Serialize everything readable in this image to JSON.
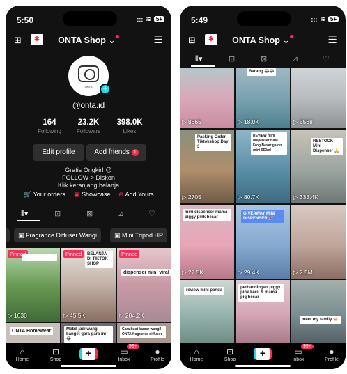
{
  "left": {
    "status": {
      "time": "5:50",
      "signal": "::: ",
      "battery": "5+"
    },
    "header": {
      "title": "ONTA Shop",
      "chevron": "⌄"
    },
    "profile": {
      "avatar_text": "ONTA",
      "handle": "@onta.id",
      "stats": [
        {
          "value": "164",
          "label": "Following"
        },
        {
          "value": "23.2K",
          "label": "Followers"
        },
        {
          "value": "398.0K",
          "label": "Likes"
        }
      ],
      "edit_profile": "Edit profile",
      "add_friends": "Add friends",
      "add_friends_badge": "1",
      "bio": [
        "Gratis Ongkir! 😉",
        "FOLLOW > Diskon",
        "Klik keranjang belanja"
      ],
      "links": {
        "orders": "Your orders",
        "showcase": "Showcase",
        "add_yours": "Add Yours"
      }
    },
    "chips": [
      "Fragrance Diffuser Wangi",
      "Mini Tripod HP"
    ],
    "tiles": [
      {
        "pinned": "Pinned",
        "caption": "...",
        "views": "1630"
      },
      {
        "pinned": "Pinned",
        "caption": "BELANJA DI TIKTOK SHOP",
        "views": "45.5K"
      },
      {
        "pinned": "Pinned",
        "caption": "dispenser mini viral",
        "views": "204.2K"
      },
      {
        "caption": "ONTA Homewear"
      },
      {
        "caption": "Mobil jadi wangi banget gara gara ini 😂"
      },
      {
        "caption": "Cara buat kamar wangi! ONTA fragrance diffuser"
      }
    ],
    "nav": {
      "home": "Home",
      "shop": "Shop",
      "create": "+",
      "inbox": "Inbox",
      "inbox_badge": "99+",
      "profile": "Profile"
    }
  },
  "right": {
    "status": {
      "time": "5:49",
      "signal": "::: ",
      "battery": "5+"
    },
    "header": {
      "title": "ONTA Shop",
      "chevron": "⌄"
    },
    "tiles": [
      {
        "caption": "Barang 😂😂",
        "views": "8665"
      },
      {
        "caption": "",
        "views": "18.0K"
      },
      {
        "caption": "",
        "views": "5568"
      },
      {
        "caption": "Packing Order Tiktokshop Day 3",
        "views": "2705"
      },
      {
        "caption": "REVIEW mini dispenser Blue Frog Besar galon mini 650ml",
        "views": "80.7K"
      },
      {
        "caption": "RESTOCK Mini Dispenser 🙏",
        "views": "338.4K"
      },
      {
        "caption": "mini dispenser mama piggy pink besar",
        "views": "27.5K"
      },
      {
        "caption": "GIVEAWAY MINI DISPENSER 🎉",
        "views": "29.4K"
      },
      {
        "caption": "",
        "views": "2.5M"
      },
      {
        "caption": "review mini panda"
      },
      {
        "caption": "perbandingan piggy pink kecil & mama pig besar"
      },
      {
        "caption": "meet my family 🐷"
      }
    ],
    "nav": {
      "home": "Home",
      "shop": "Shop",
      "create": "+",
      "inbox": "Inbox",
      "inbox_badge": "99+",
      "profile": "Profile"
    }
  },
  "colors": {
    "accent": "#fe2c55",
    "cyan": "#20d5ec",
    "bg": "#121212"
  },
  "icons": {
    "qr": "qr-code-icon",
    "menu": "hamburger-menu-icon",
    "grid": "grid-icon",
    "lock": "lock-icon",
    "bag": "shopping-bag-icon",
    "repost": "repost-icon",
    "like": "heart-hand-icon"
  }
}
